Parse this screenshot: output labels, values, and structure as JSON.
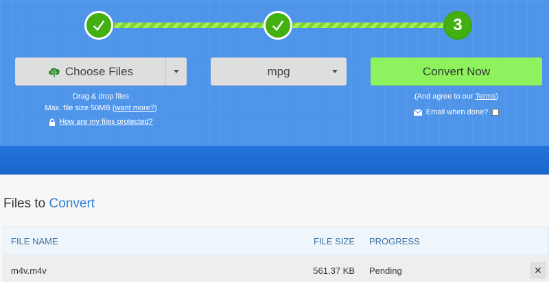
{
  "steps": [
    {
      "number": "",
      "state": "done"
    },
    {
      "number": "",
      "state": "done"
    },
    {
      "number": "3",
      "state": "current"
    }
  ],
  "toolbar": {
    "choose_label": "Choose Files",
    "format_value": "mpg",
    "convert_label": "Convert Now"
  },
  "upload_info": {
    "drag_text": "Drag & drop files",
    "max_size_text": "Max. file size 50MB (",
    "want_more_link": "want more?",
    "max_size_suffix": ")",
    "protected_link": "How are my files protected?"
  },
  "convert_info": {
    "agree_text": "(And agree to our ",
    "terms_link": "Terms",
    "agree_suffix": ")",
    "email_label": "Email when done?"
  },
  "files_section": {
    "title_prefix": "Files to ",
    "title_accent": "Convert",
    "columns": [
      "FILE NAME",
      "FILE SIZE",
      "PROGRESS"
    ],
    "rows": [
      {
        "name": "m4v.m4v",
        "size": "561.37 KB",
        "progress": "Pending"
      }
    ],
    "remove_symbol": "✕"
  },
  "colors": {
    "hero_blue": "#4e95ea",
    "band_blue": "#1e6fd6",
    "step_green": "#43b012",
    "convert_green": "#8ef25e",
    "accent_blue": "#2b7fd6"
  }
}
